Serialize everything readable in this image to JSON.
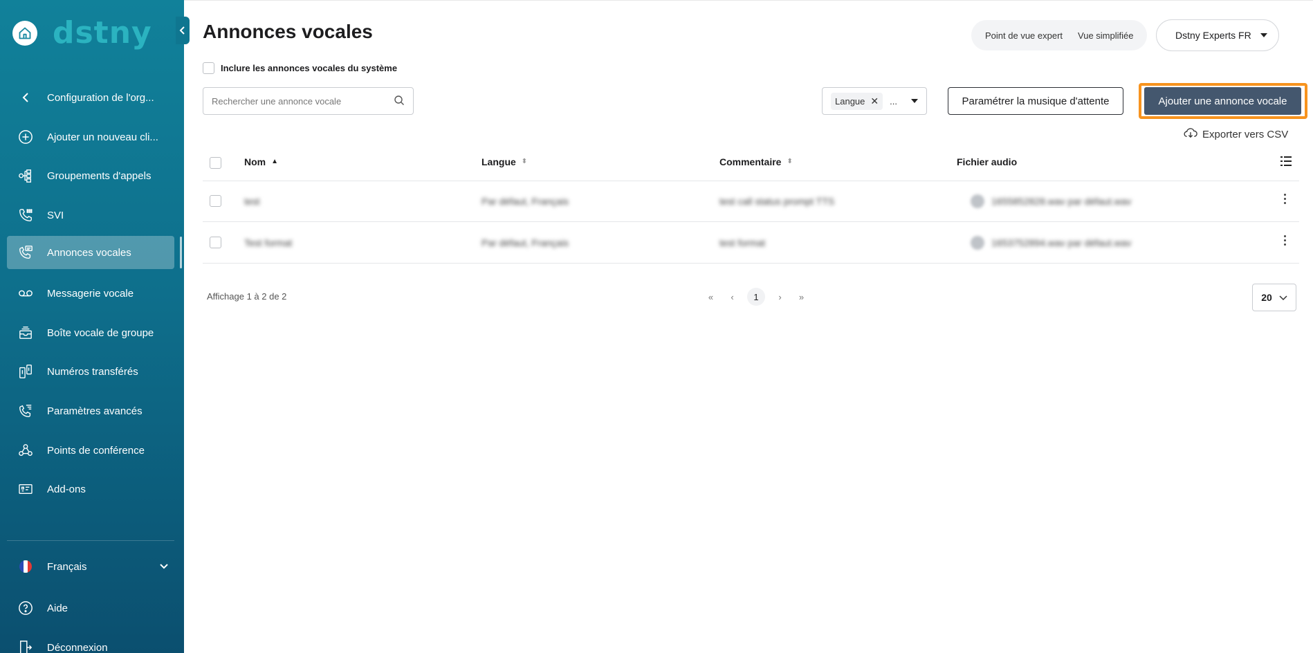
{
  "brand": {
    "logo_text": "dstny"
  },
  "sidebar": {
    "back_label": "Configuration de l'org...",
    "items": [
      {
        "label": "Ajouter un nouveau cli...",
        "icon": "plus-circle-icon"
      },
      {
        "label": "Groupements d'appels",
        "icon": "call-group-icon"
      },
      {
        "label": "SVI",
        "icon": "ivr-icon"
      },
      {
        "label": "Annonces vocales",
        "icon": "voice-announcement-icon",
        "active": true
      },
      {
        "label": "Messagerie vocale",
        "icon": "voicemail-icon"
      },
      {
        "label": "Boîte vocale de groupe",
        "icon": "group-inbox-icon"
      },
      {
        "label": "Numéros transférés",
        "icon": "forwarded-numbers-icon"
      },
      {
        "label": "Paramètres avancés",
        "icon": "advanced-settings-icon"
      },
      {
        "label": "Points de conférence",
        "icon": "conference-icon"
      },
      {
        "label": "Add-ons",
        "icon": "addons-icon"
      }
    ],
    "language": "Français",
    "help": "Aide",
    "logout": "Déconnexion"
  },
  "header": {
    "title": "Annonces vocales",
    "view_expert": "Point de vue expert",
    "view_simple": "Vue simplifiée",
    "account": "Dstny Experts FR"
  },
  "toolbar": {
    "include_system": "Inclure les annonces vocales du système",
    "search_placeholder": "Rechercher une annonce vocale",
    "lang_chip": "Langue",
    "lang_more": "...",
    "hold_music_button": "Paramétrer la musique d'attente",
    "add_button": "Ajouter une annonce vocale",
    "export": "Exporter vers CSV",
    "highlight_color": "#f7931e"
  },
  "table": {
    "columns": [
      "Nom",
      "Langue",
      "Commentaire",
      "Fichier audio"
    ],
    "rows": [
      {
        "nom": "test",
        "langue": "Par défaut, Français",
        "commentaire": "test call status prompt TTS",
        "fichier": "1655852828.wav par défaut.wav"
      },
      {
        "nom": "Test format",
        "langue": "Par défaut, Français",
        "commentaire": "test format",
        "fichier": "1653752894.wav par défaut.wav"
      }
    ]
  },
  "footer": {
    "info": "Affichage 1 à 2 de 2",
    "current_page": "1",
    "page_size": "20"
  }
}
